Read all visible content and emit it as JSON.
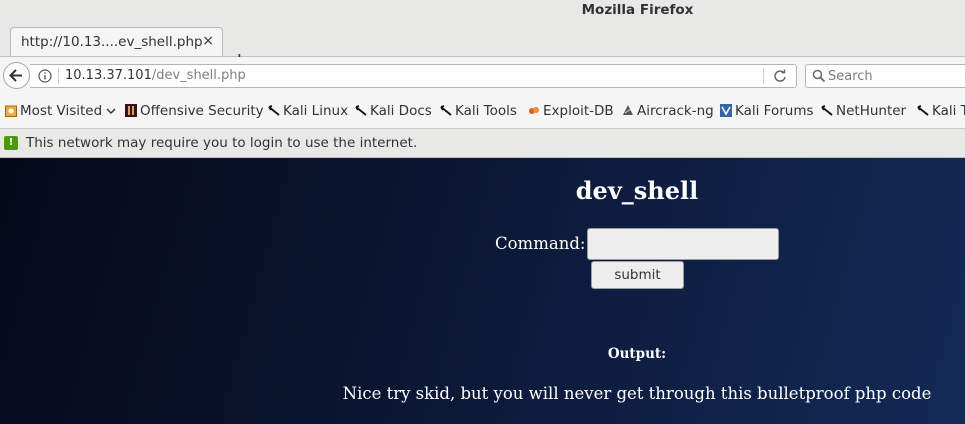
{
  "window": {
    "title": "Mozilla Firefox"
  },
  "tab": {
    "label": "http://10.13....ev_shell.php",
    "close": "×",
    "new_tab": "+"
  },
  "nav": {
    "url_host": "10.13.37.101",
    "url_path": "/dev_shell.php",
    "search_placeholder": "Search"
  },
  "bookmarks": [
    {
      "label": "Most Visited",
      "icon": "most-visited-icon"
    },
    {
      "label": "Offensive Security",
      "icon": "offsec-icon"
    },
    {
      "label": "Kali Linux",
      "icon": "kali-dragon-icon"
    },
    {
      "label": "Kali Docs",
      "icon": "kali-dragon-icon"
    },
    {
      "label": "Kali Tools",
      "icon": "kali-dragon-icon"
    },
    {
      "label": "Exploit-DB",
      "icon": "exploit-db-icon"
    },
    {
      "label": "Aircrack-ng",
      "icon": "aircrack-icon"
    },
    {
      "label": "Kali Forums",
      "icon": "kali-forums-icon"
    },
    {
      "label": "NetHunter",
      "icon": "kali-dragon-icon"
    },
    {
      "label": "Kali T",
      "icon": "kali-dragon-icon"
    }
  ],
  "notification": {
    "text": "This network may require you to login to use the internet."
  },
  "page": {
    "heading": "dev_shell",
    "command_label": "Command:",
    "command_value": "",
    "submit_label": "submit",
    "output_label": "Output:",
    "output_text": "Nice try skid, but you will never get through this bulletproof php code"
  }
}
